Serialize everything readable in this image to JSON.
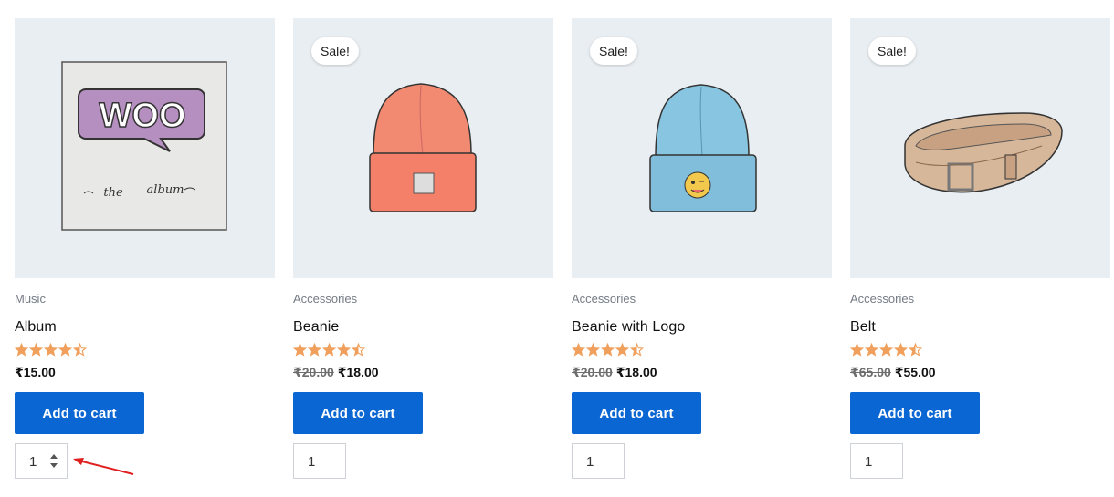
{
  "colors": {
    "accent": "#0a66d2",
    "star": "#f0a05c",
    "thumb_bg": "#e9eef2",
    "annotation": "#e02020"
  },
  "products": [
    {
      "category": "Music",
      "title": "Album",
      "rating": 4.5,
      "sale_label": "",
      "price_old": "",
      "price": "₹15.00",
      "button": "Add to cart",
      "qty": "1",
      "image_text": {
        "big": "WOO",
        "small_left": "the",
        "small_right": "album"
      }
    },
    {
      "category": "Accessories",
      "title": "Beanie",
      "rating": 4.5,
      "sale_label": "Sale!",
      "price_old": "₹20.00",
      "price": "₹18.00",
      "button": "Add to cart",
      "qty": "1"
    },
    {
      "category": "Accessories",
      "title": "Beanie with Logo",
      "rating": 4.5,
      "sale_label": "Sale!",
      "price_old": "₹20.00",
      "price": "₹18.00",
      "button": "Add to cart",
      "qty": "1"
    },
    {
      "category": "Accessories",
      "title": "Belt",
      "rating": 4.5,
      "sale_label": "Sale!",
      "price_old": "₹65.00",
      "price": "₹55.00",
      "button": "Add to cart",
      "qty": "1"
    }
  ]
}
